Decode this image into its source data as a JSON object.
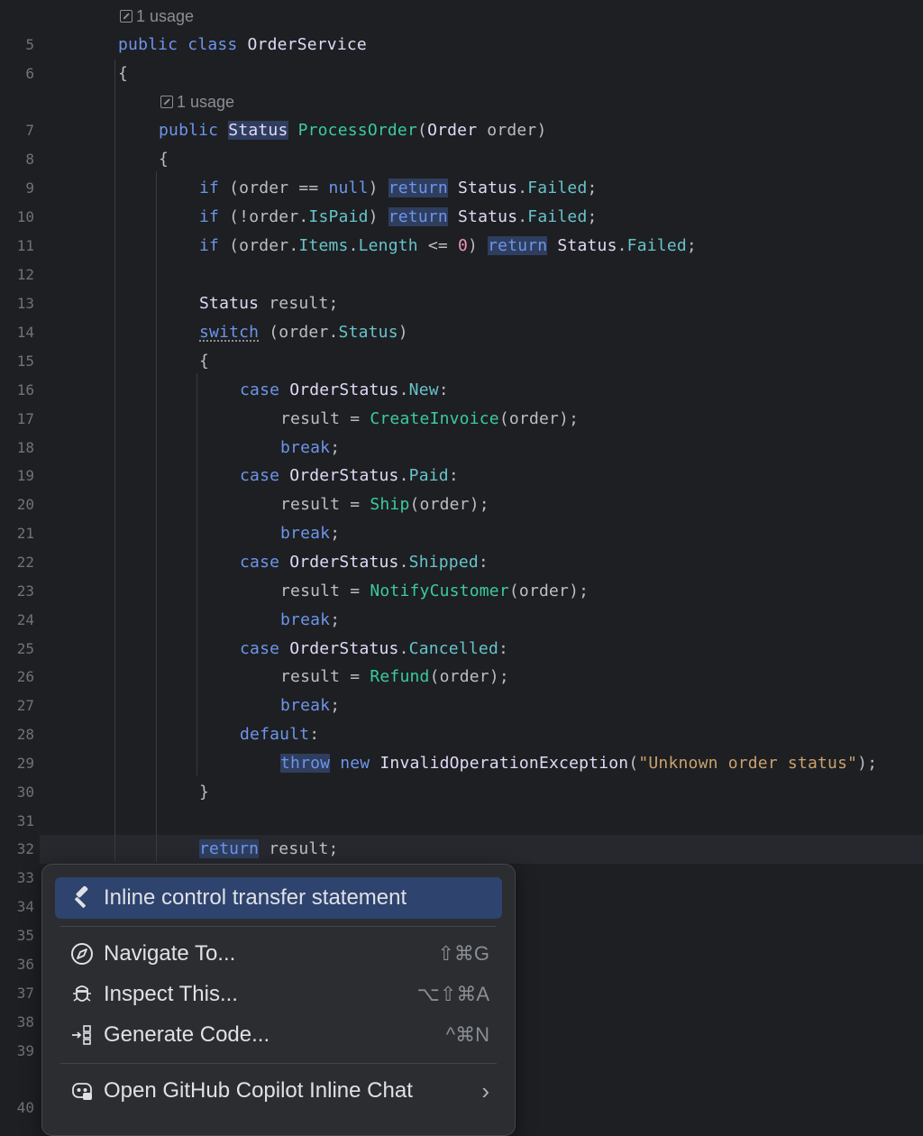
{
  "editor": {
    "line_numbers": [
      "5",
      "6",
      "7",
      "8",
      "9",
      "10",
      "11",
      "12",
      "13",
      "14",
      "15",
      "16",
      "17",
      "18",
      "19",
      "20",
      "21",
      "22",
      "23",
      "24",
      "25",
      "26",
      "27",
      "28",
      "29",
      "30",
      "31",
      "32",
      "33",
      "34",
      "35",
      "36",
      "37",
      "38",
      "39",
      "40"
    ],
    "usage_hint_class": "1 usage",
    "usage_hint_method": "1 usage",
    "code": {
      "l5_public": "public",
      "l5_class": "class",
      "l5_name": "OrderService",
      "l6": "{",
      "l7_public": "public",
      "l7_status": "Status",
      "l7_method": "ProcessOrder",
      "l7_paren": "(",
      "l7_type": "Order",
      "l7_rest": " order)",
      "l8": "{",
      "l9_if": "if",
      "l9_a": " (order == ",
      "l9_null": "null",
      "l9_b": ") ",
      "l9_return": "return",
      "l9_status": " Status",
      "l9_dot": ".",
      "l9_enum": "Failed",
      "l9_semi": ";",
      "l10_if": "if",
      "l10_a": " (!order.",
      "l10_prop": "IsPaid",
      "l10_b": ") ",
      "l10_return": "return",
      "l10_status": " Status",
      "l10_dot": ".",
      "l10_enum": "Failed",
      "l10_semi": ";",
      "l11_if": "if",
      "l11_a": " (order.",
      "l11_items": "Items",
      "l11_dot1": ".",
      "l11_len": "Length",
      "l11_b": " <= ",
      "l11_zero": "0",
      "l11_c": ") ",
      "l11_return": "return",
      "l11_status": " Status",
      "l11_dot": ".",
      "l11_enum": "Failed",
      "l11_semi": ";",
      "l13_status": "Status",
      "l13_rest": " result;",
      "l14_switch": "switch",
      "l14_a": " (order.",
      "l14_prop": "Status",
      "l14_b": ")",
      "l15": "{",
      "l16_case": "case",
      "l16_type": " OrderStatus",
      "l16_dot": ".",
      "l16_enum": "New",
      "l16_colon": ":",
      "l17_a": "result = ",
      "l17_fn": "CreateInvoice",
      "l17_b": "(order);",
      "l18_break": "break",
      "l18_semi": ";",
      "l19_case": "case",
      "l19_type": " OrderStatus",
      "l19_dot": ".",
      "l19_enum": "Paid",
      "l19_colon": ":",
      "l20_a": "result = ",
      "l20_fn": "Ship",
      "l20_b": "(order);",
      "l21_break": "break",
      "l21_semi": ";",
      "l22_case": "case",
      "l22_type": " OrderStatus",
      "l22_dot": ".",
      "l22_enum": "Shipped",
      "l22_colon": ":",
      "l23_a": "result = ",
      "l23_fn": "NotifyCustomer",
      "l23_b": "(order);",
      "l24_break": "break",
      "l24_semi": ";",
      "l25_case": "case",
      "l25_type": " OrderStatus",
      "l25_dot": ".",
      "l25_enum": "Cancelled",
      "l25_colon": ":",
      "l26_a": "result = ",
      "l26_fn": "Refund",
      "l26_b": "(order);",
      "l27_break": "break",
      "l27_semi": ";",
      "l28_default": "default",
      "l28_colon": ":",
      "l29_throw": "throw",
      "l29_new": " new",
      "l29_type": " InvalidOperationException",
      "l29_paren": "(",
      "l29_str": "\"Unknown order status\"",
      "l29_end": ");",
      "l30": "}",
      "l32_return": "return",
      "l32_rest": " result;"
    }
  },
  "context_menu": {
    "items": [
      {
        "label": "Inline control transfer statement",
        "shortcut": "",
        "icon": "hammer-icon",
        "selected": true
      },
      {
        "label": "Navigate To...",
        "shortcut": "⇧⌘G",
        "icon": "compass-icon"
      },
      {
        "label": "Inspect This...",
        "shortcut": "⌥⇧⌘A",
        "icon": "bug-icon"
      },
      {
        "label": "Generate Code...",
        "shortcut": "^⌘N",
        "icon": "generate-code-icon"
      },
      {
        "label": "Open GitHub Copilot Inline Chat",
        "shortcut": "›",
        "icon": "copilot-icon"
      }
    ]
  },
  "colors": {
    "background": "#1e1f22",
    "keyword": "#6c95eb",
    "function": "#39cc9b",
    "enum_member": "#66c3cc",
    "string": "#c9a26d",
    "menu_selection": "#2e436e"
  }
}
